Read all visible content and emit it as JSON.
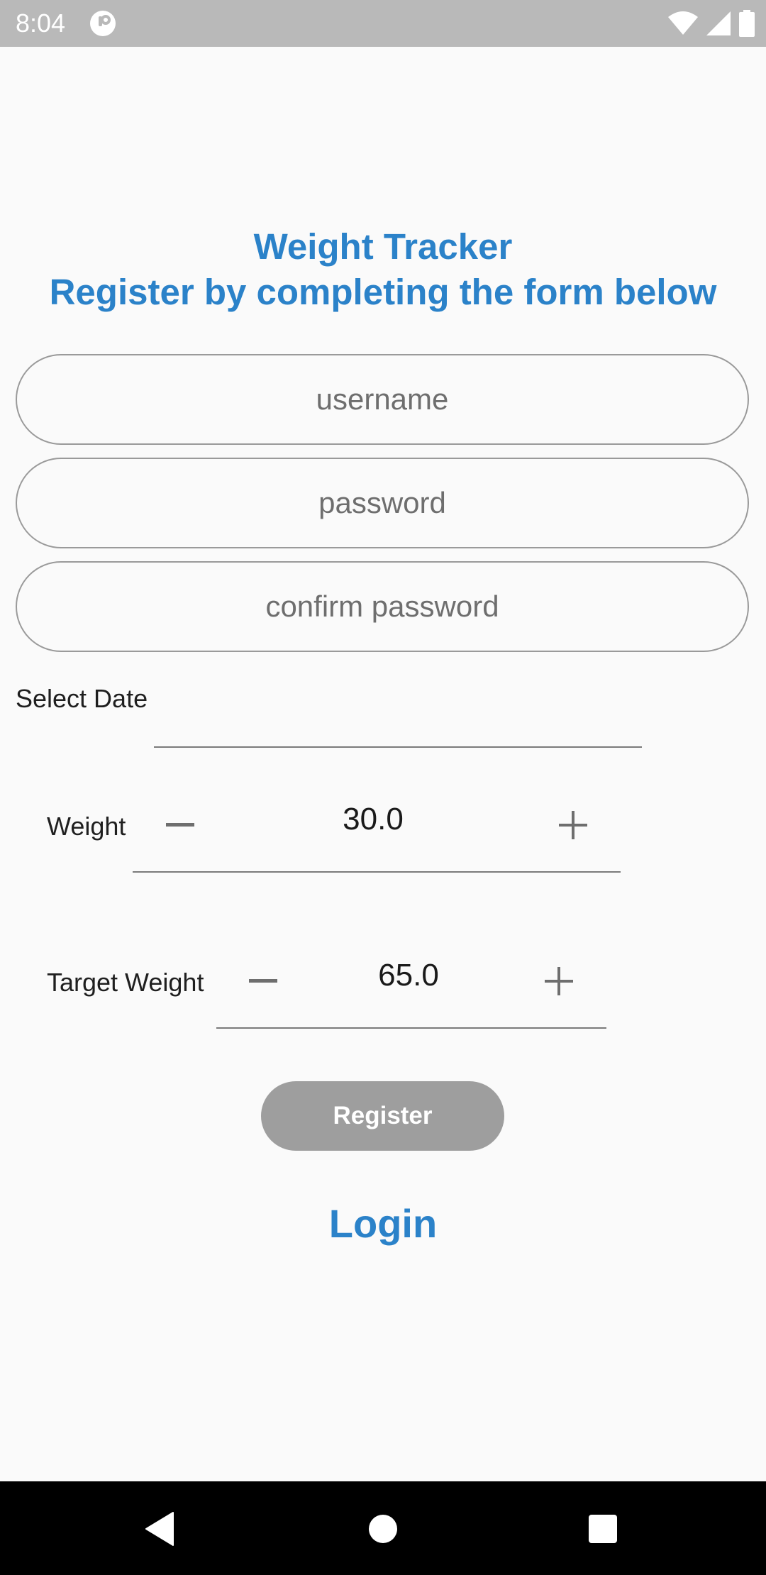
{
  "status_bar": {
    "time": "8:04",
    "icons": [
      "app-notification-icon",
      "wifi-icon",
      "signal-icon",
      "battery-icon"
    ]
  },
  "header": {
    "title": "Weight Tracker",
    "subtitle": "Register by completing the form below"
  },
  "form": {
    "username_placeholder": "username",
    "password_placeholder": "password",
    "confirm_password_placeholder": "confirm password",
    "select_date_label": "Select Date",
    "weight": {
      "label": "Weight",
      "value": "30.0"
    },
    "target_weight": {
      "label": "Target Weight",
      "value": "65.0"
    },
    "register_label": "Register",
    "login_label": "Login"
  },
  "colors": {
    "accent": "#2B82C9",
    "background": "#FAFAFA",
    "button_disabled": "#9E9E9E",
    "status_bar": "#B9B9B9",
    "nav_bar": "#000000"
  },
  "nav_bar": {
    "icons": [
      "back-icon",
      "home-icon",
      "recents-icon"
    ]
  }
}
